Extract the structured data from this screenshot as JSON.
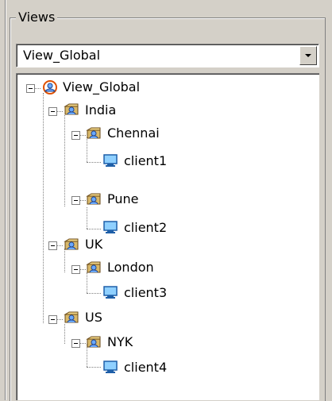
{
  "group": {
    "title": "Views"
  },
  "view_select": {
    "value": "View_Global"
  },
  "tree": {
    "root": "View_Global",
    "nodes": [
      {
        "label": "View_Global",
        "type": "global"
      },
      {
        "label": "India",
        "type": "group"
      },
      {
        "label": "Chennai",
        "type": "group"
      },
      {
        "label": "client1",
        "type": "client"
      },
      {
        "label": "Pune",
        "type": "group"
      },
      {
        "label": "client2",
        "type": "client"
      },
      {
        "label": "UK",
        "type": "group"
      },
      {
        "label": "London",
        "type": "group"
      },
      {
        "label": "client3",
        "type": "client"
      },
      {
        "label": "US",
        "type": "group"
      },
      {
        "label": "NYK",
        "type": "group"
      },
      {
        "label": "client4",
        "type": "client"
      }
    ]
  }
}
